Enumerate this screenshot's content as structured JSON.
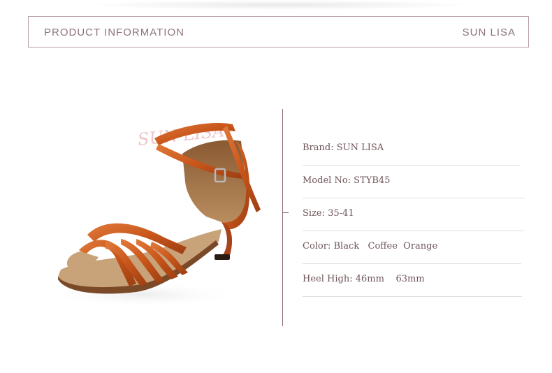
{
  "header": {
    "left_label": "PRODUCT INFORMATION",
    "right_label": "SUN LISA"
  },
  "product_image": {
    "watermark_text": "SUN LISA",
    "shoe_color": "#c9561b",
    "sole_color": "#c8a37a",
    "heel_color": "#a8441a"
  },
  "info": {
    "rows": [
      {
        "text": "Brand: SUN LISA"
      },
      {
        "text": "Model No: STYB45"
      },
      {
        "text": "Size: 35-41"
      },
      {
        "text": "Color: Black   Coffee  Orange"
      },
      {
        "text": "Heel High: 46mm    63mm"
      }
    ]
  },
  "colors": {
    "accent": "#8e7478",
    "divider": "#8a6a6e",
    "row_line": "#e3dede"
  }
}
